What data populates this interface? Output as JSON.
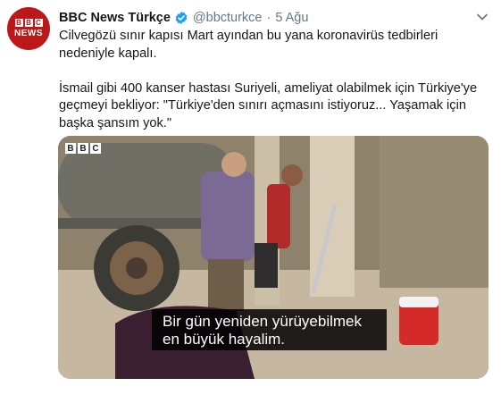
{
  "tweet": {
    "author_name": "BBC News Türkçe",
    "handle": "@bbcturkce",
    "separator": "·",
    "date": "5 Ağu",
    "paragraph_1": "Cilvegözü sınır kapısı Mart ayından bu yana koronavirüs tedbirleri nedeniyle kapalı.",
    "paragraph_2": "İsmail gibi 400 kanser hastası Suriyeli, ameliyat olabilmek için Türkiye'ye geçmeyi bekliyor: \"Türkiye'den sınırı açmasını istiyoruz... Yaşamak için başka şansım yok.\""
  },
  "avatar": {
    "logo_letters": [
      "B",
      "B",
      "C"
    ],
    "word": "NEWS"
  },
  "media": {
    "logo_letters": [
      "B",
      "B",
      "C"
    ],
    "subtitle_line_1": "Bir gün yeniden yürüyebilmek",
    "subtitle_line_2": "en büyük hayalim."
  },
  "colors": {
    "brand_red": "#bb1919",
    "verified_blue": "#1da1f2",
    "meta_gray": "#657786"
  },
  "icons": {
    "verified": "verified-badge-icon",
    "menu": "chevron-down-icon"
  }
}
